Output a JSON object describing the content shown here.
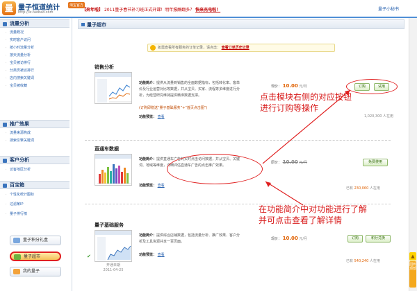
{
  "header": {
    "logo_badge": "量",
    "logo_text": "量子恒道统计",
    "logo_tag": "淘宝官方",
    "logo_url": "http://lz.taobao.com",
    "notice_prefix": "【奔年啦】",
    "notice_text": "2011量子春节补习班正式开课！明年报酬翻多？",
    "notice_link": "快来充电啦！",
    "user_link": "量子小秘书"
  },
  "sidebar": {
    "groups": [
      {
        "title": "流量分析",
        "items": [
          "流量概况",
          "实时客户访问",
          "按小时流量分析",
          "按天流量分析",
          "宝贝被访排行",
          "分类页被访排行",
          "店内搜索关键词",
          "宝贝被收藏"
        ]
      },
      {
        "title": "推广效果",
        "items": [
          "流量来源构成",
          "搜索引擎关键词"
        ]
      },
      {
        "title": "客户分析",
        "items": [
          "访客地区分析"
        ]
      },
      {
        "title": "百宝箱",
        "items": [
          "个性化统计图标",
          "过滤某IP",
          "量子排行榜"
        ]
      }
    ],
    "buttons": [
      {
        "label": "量子积分礼盒",
        "icon": "gift-icon"
      },
      {
        "label": "量子超市",
        "icon": "shop-icon"
      },
      {
        "label": "我的量子",
        "icon": "user-icon"
      }
    ]
  },
  "main": {
    "panel_title": "量子超市",
    "tip_text": "如需查看所有服务的订单记录，请点击：",
    "tip_link": "查看订单历史记录",
    "modules": [
      {
        "title": "销售分析",
        "desc_label": "功能简介：",
        "desc": "提供从流量到销售的全面数据指标，包括转化率、客单价及行业运营对比等数据，并从宝贝、买家、流程等多维度进行分析，为经营研究维持提供精准数据支撑。",
        "extra": "(订购即赠送“量子基础服务”+“首页点击图”)",
        "pay_label": "功能预览：",
        "pay_link": "查看",
        "price_label": "现价：",
        "price_value": "10.00",
        "price_unit": "元/月",
        "buttons": [
          "订购",
          "试用"
        ],
        "users": "1,020,300 人在用"
      },
      {
        "title": "直通车数据",
        "desc_label": "功能简介：",
        "desc": "提供直通车广告的实时点击访问数据，并从宝贝、关键词、地域等维度，详细评估直通车广告的点击推广效果。",
        "pay_label": "功能预览：",
        "pay_link": "查看",
        "price_label": "原价：",
        "price_old": "10.00",
        "price_unit": "元/月",
        "buttons": [
          "免费使用"
        ],
        "users_prefix": "已有",
        "users_count": "230,060",
        "users_suffix": "人在用"
      },
      {
        "title": "量子基础服务",
        "desc_label": "功能简介：",
        "desc": "提供综合店铺数据，包括流量分析、推广效果、客户分析及工具资源共享一百页面。",
        "pay_label": "功能预览：",
        "pay_link": "查看",
        "price_label": "现价：",
        "price_value": "10.00",
        "price_unit": "元/月",
        "buttons": [
          "订购",
          "积分兑换"
        ],
        "users_prefix": "已有",
        "users_count": "540,240",
        "users_suffix": "人在用",
        "caption_lines": [
          "开通日期",
          "2011-04-25"
        ]
      }
    ]
  },
  "annotations": {
    "callout1_line1": "点击模块右侧的对应按钮",
    "callout1_line2": "进行订购等操作",
    "callout2_line1": "在功能简介中对功能进行了解",
    "callout2_line2": "并可点击查看了解详情"
  },
  "floating": {
    "scroll_up": "▲",
    "back_top": "回到顶部"
  },
  "colors": {
    "accent_blue": "#3a74bd",
    "price_orange": "#e06000",
    "annotation_red": "#d81b1b",
    "button_green": "#2e6b00"
  }
}
